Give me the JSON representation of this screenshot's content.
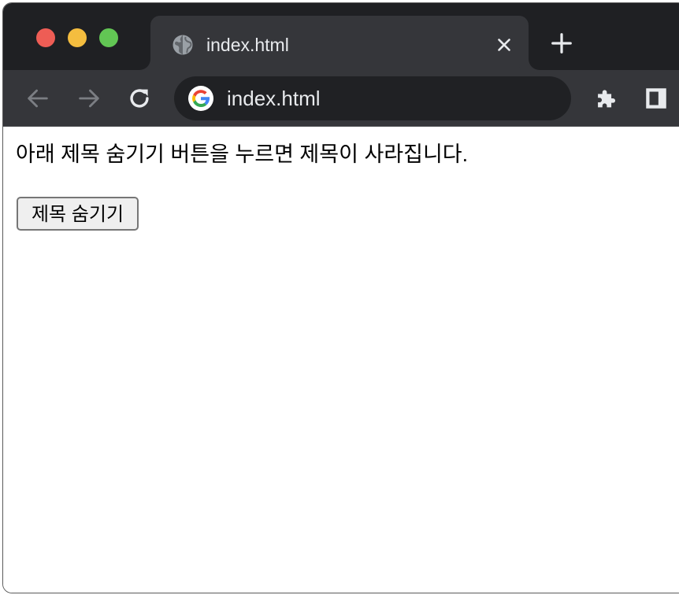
{
  "browser": {
    "tab": {
      "title": "index.html",
      "favicon": "globe-icon"
    },
    "address_bar": {
      "text": "index.html",
      "engine_icon": "google-g-icon"
    },
    "toolbar_icons": [
      "back-arrow-icon",
      "forward-arrow-icon",
      "reload-icon",
      "puzzle-extension-icon",
      "side-panel-icon"
    ],
    "colors": {
      "tabbar_bg": "#1f2023",
      "active_tab_bg": "#35363a",
      "omnibox_bg": "#202124",
      "close_red": "#ee5d55",
      "minimize_yellow": "#f4bd3f",
      "zoom_green": "#62c654"
    }
  },
  "page": {
    "hint_text": "아래 제목 숨기기 버튼을 누르면 제목이 사라집니다.",
    "hide_button_label": "제목 숨기기"
  }
}
